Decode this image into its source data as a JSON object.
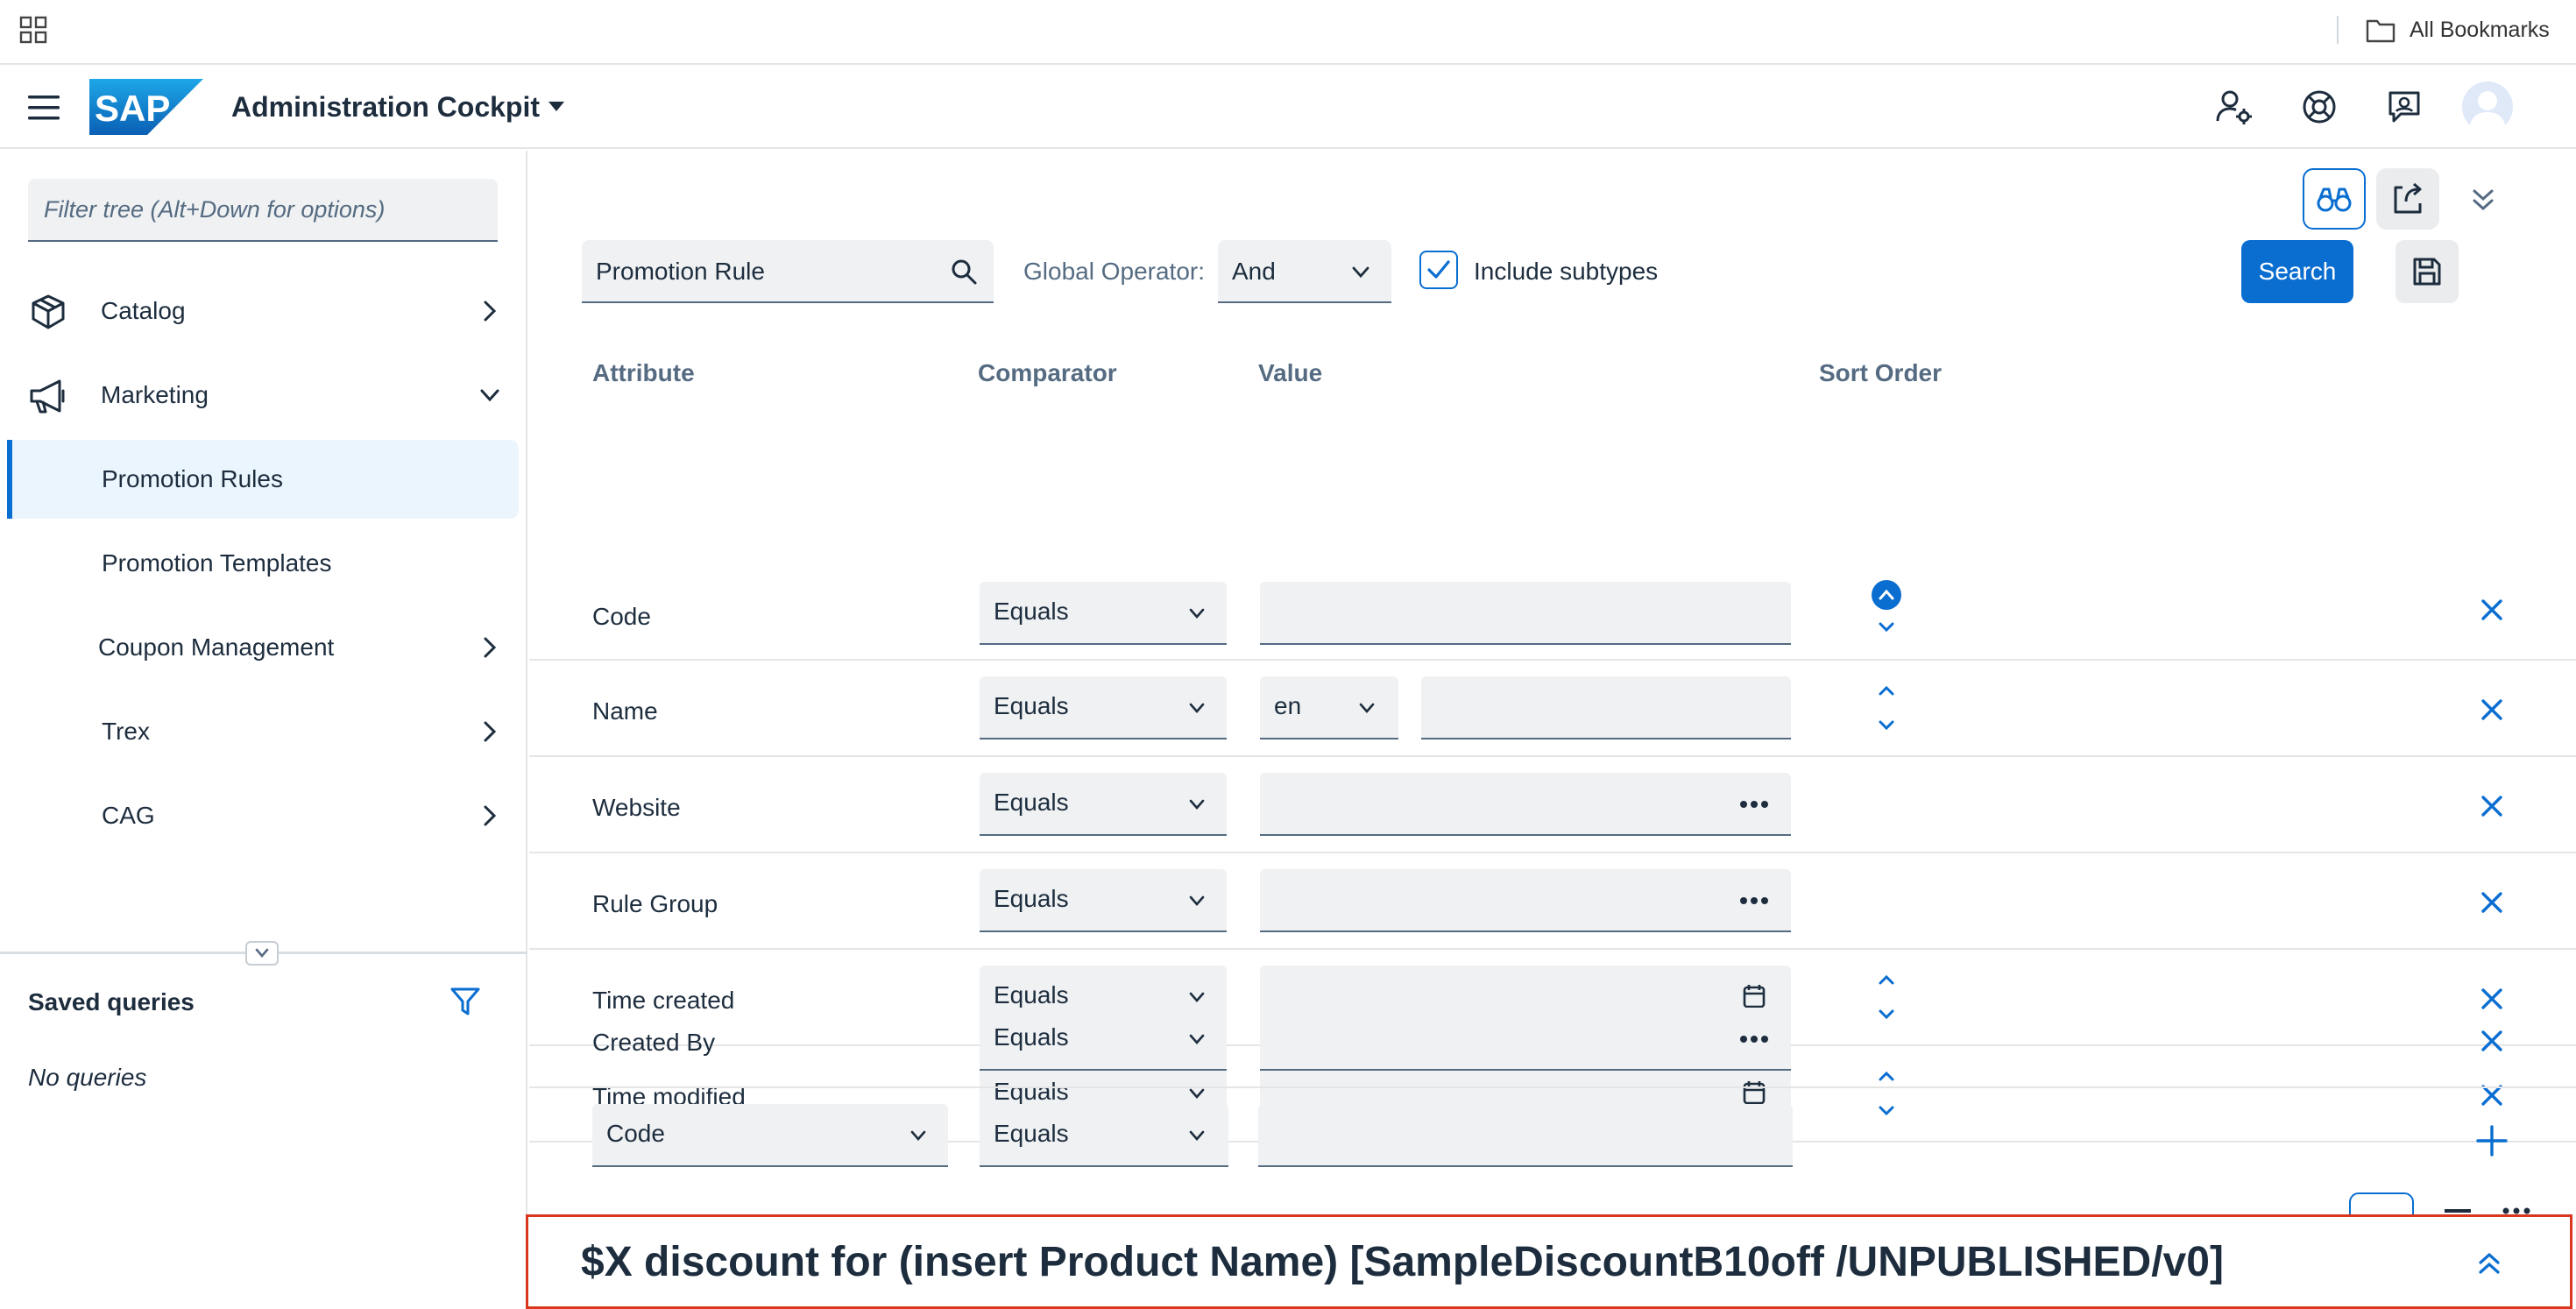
{
  "browser": {
    "bookmarks_label": "All Bookmarks"
  },
  "shell": {
    "logo_text": "SAP",
    "title": "Administration Cockpit"
  },
  "sidebar": {
    "filter_placeholder": "Filter tree (Alt+Down for options)",
    "items": [
      {
        "label": "Catalog",
        "icon": "catalog-icon",
        "expanded": false
      },
      {
        "label": "Marketing",
        "icon": "megaphone-icon",
        "expanded": true
      },
      {
        "label": "Promotion Rules",
        "selected": true
      },
      {
        "label": "Promotion Templates"
      },
      {
        "label": "Coupon Management",
        "expanded": false
      },
      {
        "label": "Trex",
        "expanded": false
      },
      {
        "label": "CAG",
        "expanded": false
      }
    ],
    "saved_queries_title": "Saved queries",
    "saved_queries_empty": "No queries"
  },
  "search": {
    "type_value": "Promotion Rule",
    "global_operator_label": "Global Operator:",
    "global_operator_value": "And",
    "include_subtypes_label": "Include subtypes",
    "include_subtypes_checked": true,
    "search_button": "Search"
  },
  "columns": {
    "attribute": "Attribute",
    "comparator": "Comparator",
    "value": "Value",
    "sort_order": "Sort Order"
  },
  "rows": [
    {
      "attribute": "Code",
      "comparator": "Equals",
      "value": "",
      "suffix": "none",
      "sort": "asc-active"
    },
    {
      "attribute": "Name",
      "comparator": "Equals",
      "language": "en",
      "value": "",
      "sort": "both"
    },
    {
      "attribute": "Website",
      "comparator": "Equals",
      "value": "",
      "suffix": "more-icon",
      "sort": "none"
    },
    {
      "attribute": "Rule Group",
      "comparator": "Equals",
      "value": "",
      "suffix": "more-icon",
      "sort": "none"
    },
    {
      "attribute": "Time created",
      "comparator": "Equals",
      "value": "",
      "suffix": "calendar-icon",
      "sort": "both"
    },
    {
      "attribute": "Time modified",
      "comparator": "Equals",
      "value": "",
      "suffix": "calendar-icon",
      "sort": "both"
    },
    {
      "attribute": "Created By",
      "comparator": "Equals",
      "value": "",
      "suffix": "more-icon",
      "sort": "none"
    }
  ],
  "add_row": {
    "attribute": "Code",
    "comparator": "Equals",
    "value": ""
  },
  "detail": {
    "title": "$X discount for (insert Product Name) [SampleDiscountB10off  /UNPUBLISHED/v0]"
  },
  "colors": {
    "accent": "#0a6ed1",
    "text": "#1d2d3e",
    "muted": "#556b82",
    "field_bg": "#eff1f2",
    "detail_border": "#d9361e"
  }
}
